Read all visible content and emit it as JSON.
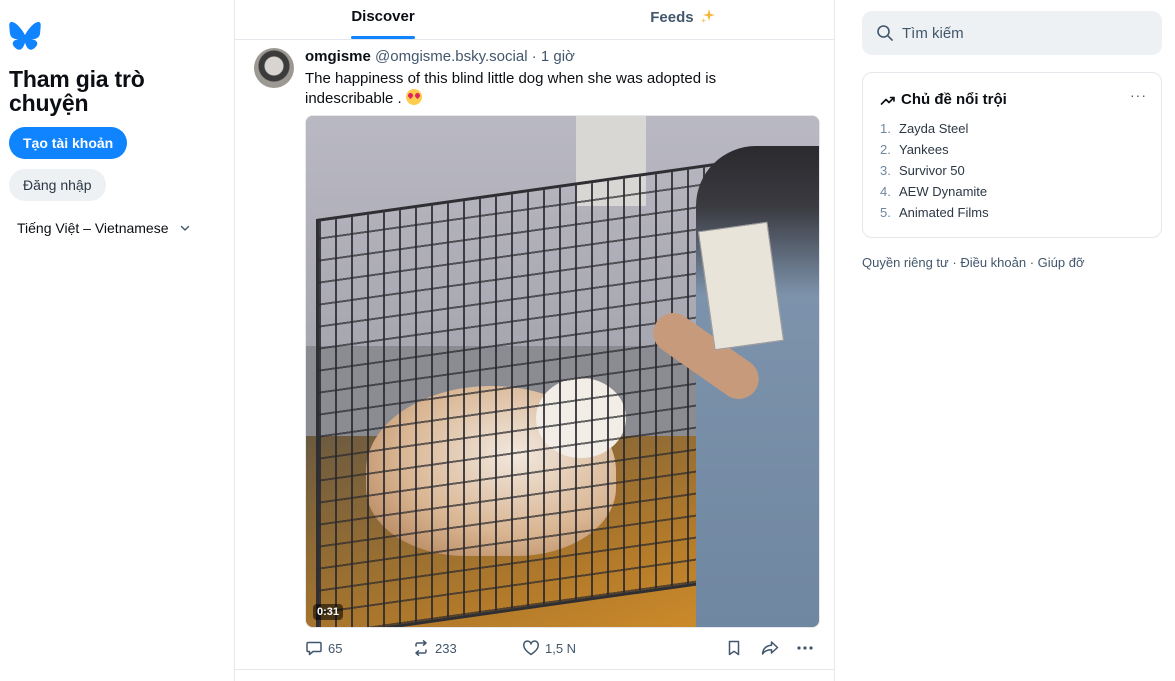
{
  "sidebar": {
    "join_title": "Tham gia trò chuyện",
    "create_account": "Tạo tài khoản",
    "sign_in": "Đăng nhập",
    "language": "Tiếng Việt – Vietnamese",
    "logo_icon": "butterfly-icon",
    "brand_color": "#1083fe"
  },
  "tabs": [
    {
      "label": "Discover",
      "active": true
    },
    {
      "label": "Feeds",
      "icon": "sparkle-icon",
      "active": false
    }
  ],
  "post": {
    "author": "omgisme",
    "handle": "@omgisme.bsky.social",
    "separator": "·",
    "time": "1 giờ",
    "text": "The happiness of this blind little dog when she was adopted is indescribable .",
    "emoji": "heart-eyes-emoji",
    "video_duration": "0:31",
    "replies": "65",
    "reposts": "233",
    "likes": "1,5 N"
  },
  "right": {
    "search_placeholder": "Tìm kiếm",
    "trending_title": "Chủ đề nổi trội",
    "trending_more": "···",
    "trending": [
      {
        "rank": "1.",
        "label": "Zayda Steel"
      },
      {
        "rank": "2.",
        "label": "Yankees"
      },
      {
        "rank": "3.",
        "label": "Survivor 50"
      },
      {
        "rank": "4.",
        "label": "AEW Dynamite"
      },
      {
        "rank": "5.",
        "label": "Animated Films"
      }
    ],
    "footer": {
      "privacy": "Quyền riêng tư",
      "terms": "Điều khoản",
      "help": "Giúp đỡ",
      "separator": " · "
    }
  }
}
